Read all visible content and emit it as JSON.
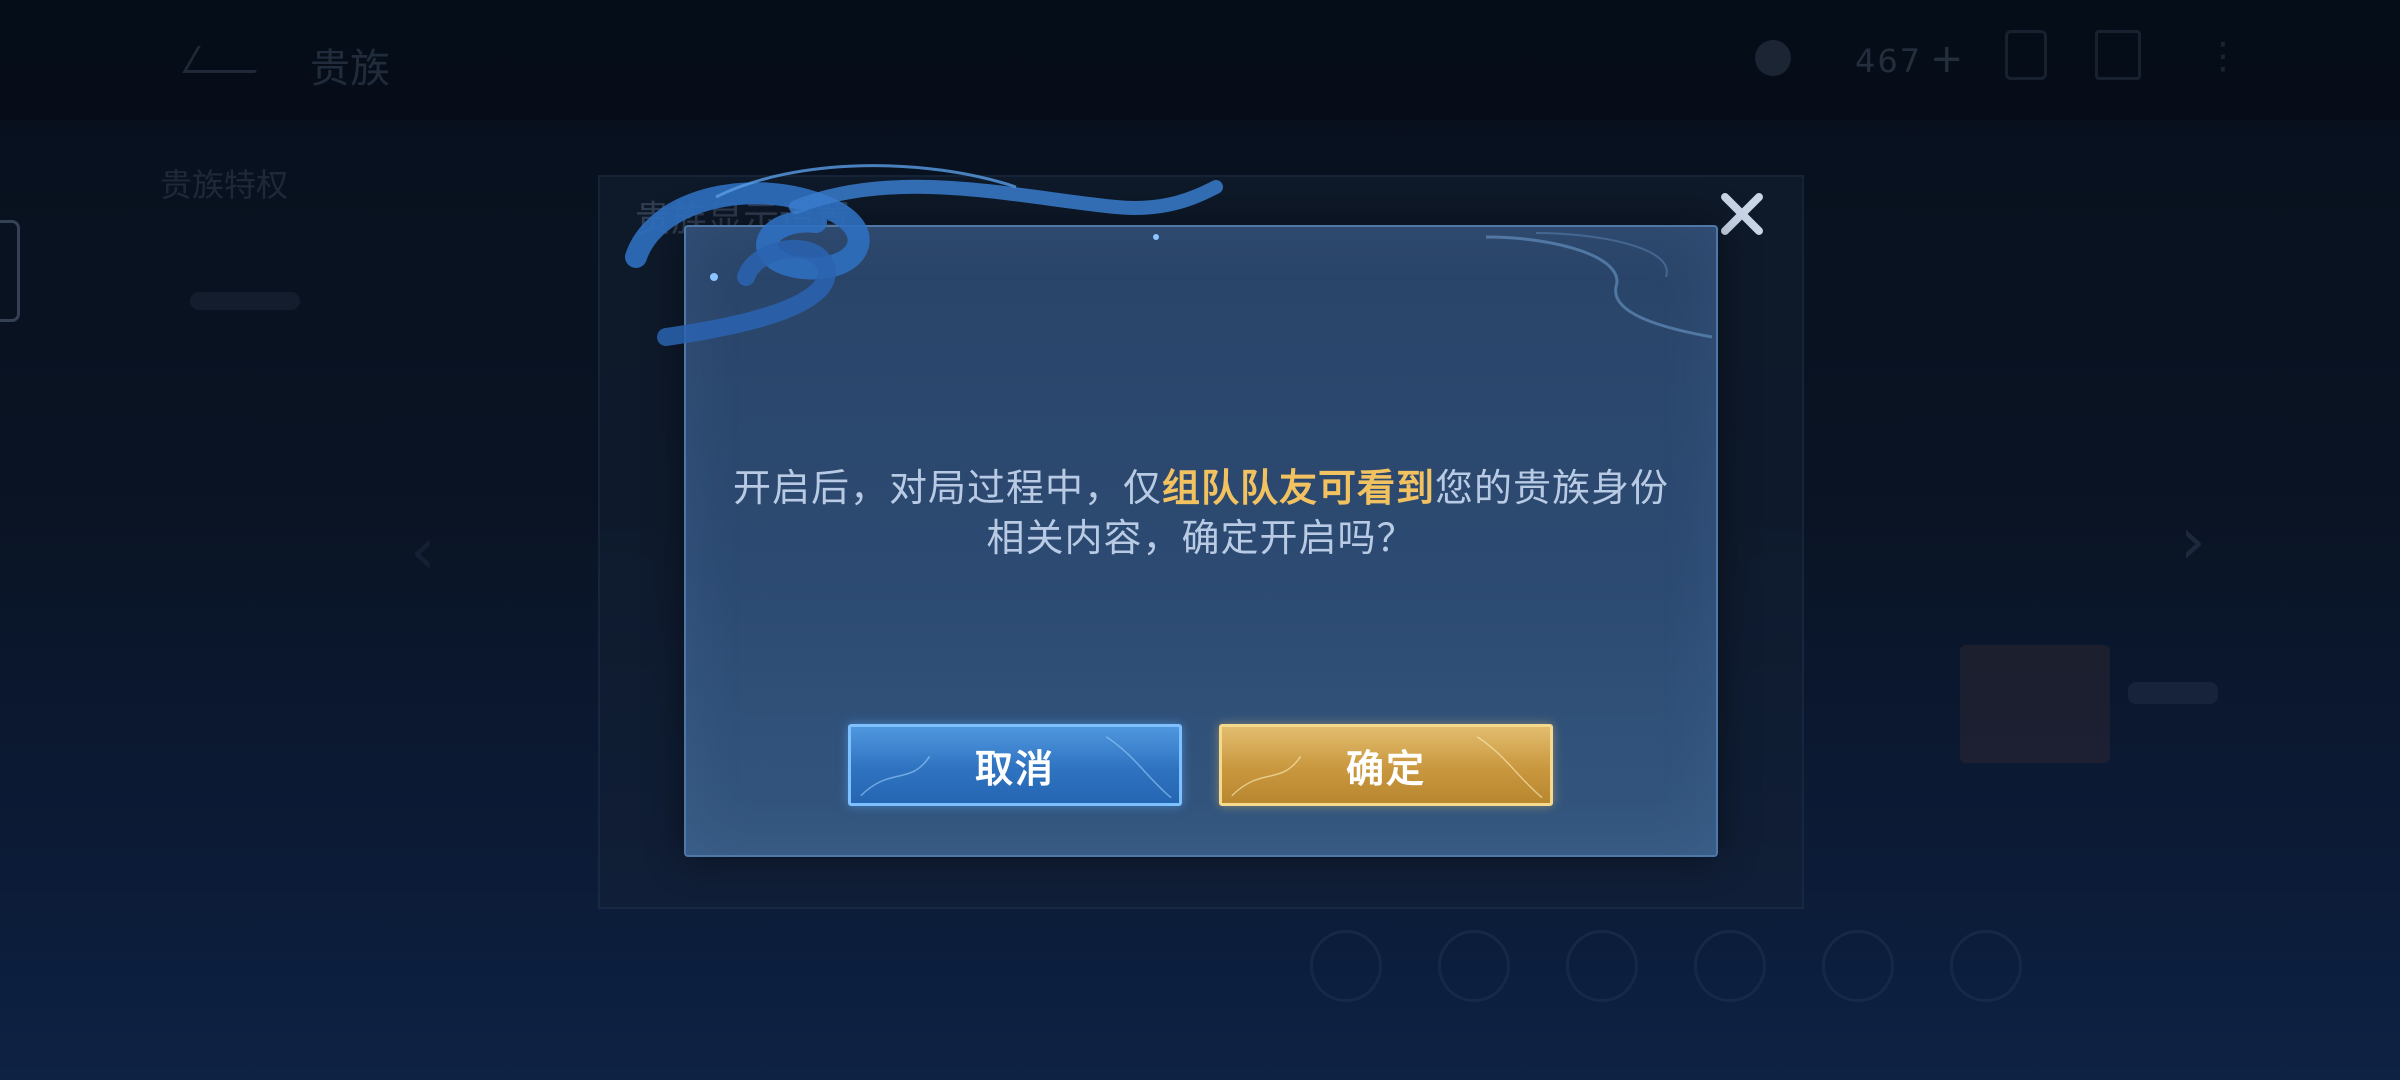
{
  "header": {
    "back_icon": "chevron-left-icon",
    "title": "贵族",
    "currency_amount": "467",
    "currency_add": "+",
    "more_icon": "more-icon"
  },
  "sidebar": {
    "title": "贵族特权"
  },
  "background_panel": {
    "title": "贵族显示设置"
  },
  "dialog": {
    "message_before": "开启后，对局过程中，仅",
    "message_highlight": "组队队友可看到",
    "message_after": "您的贵族身份相关内容，确定开启吗？",
    "cancel_label": "取消",
    "confirm_label": "确定",
    "close_icon": "close-icon"
  },
  "colors": {
    "highlight": "#f2c260",
    "cancel_button": "#2f73c0",
    "confirm_button": "#c9973e"
  }
}
